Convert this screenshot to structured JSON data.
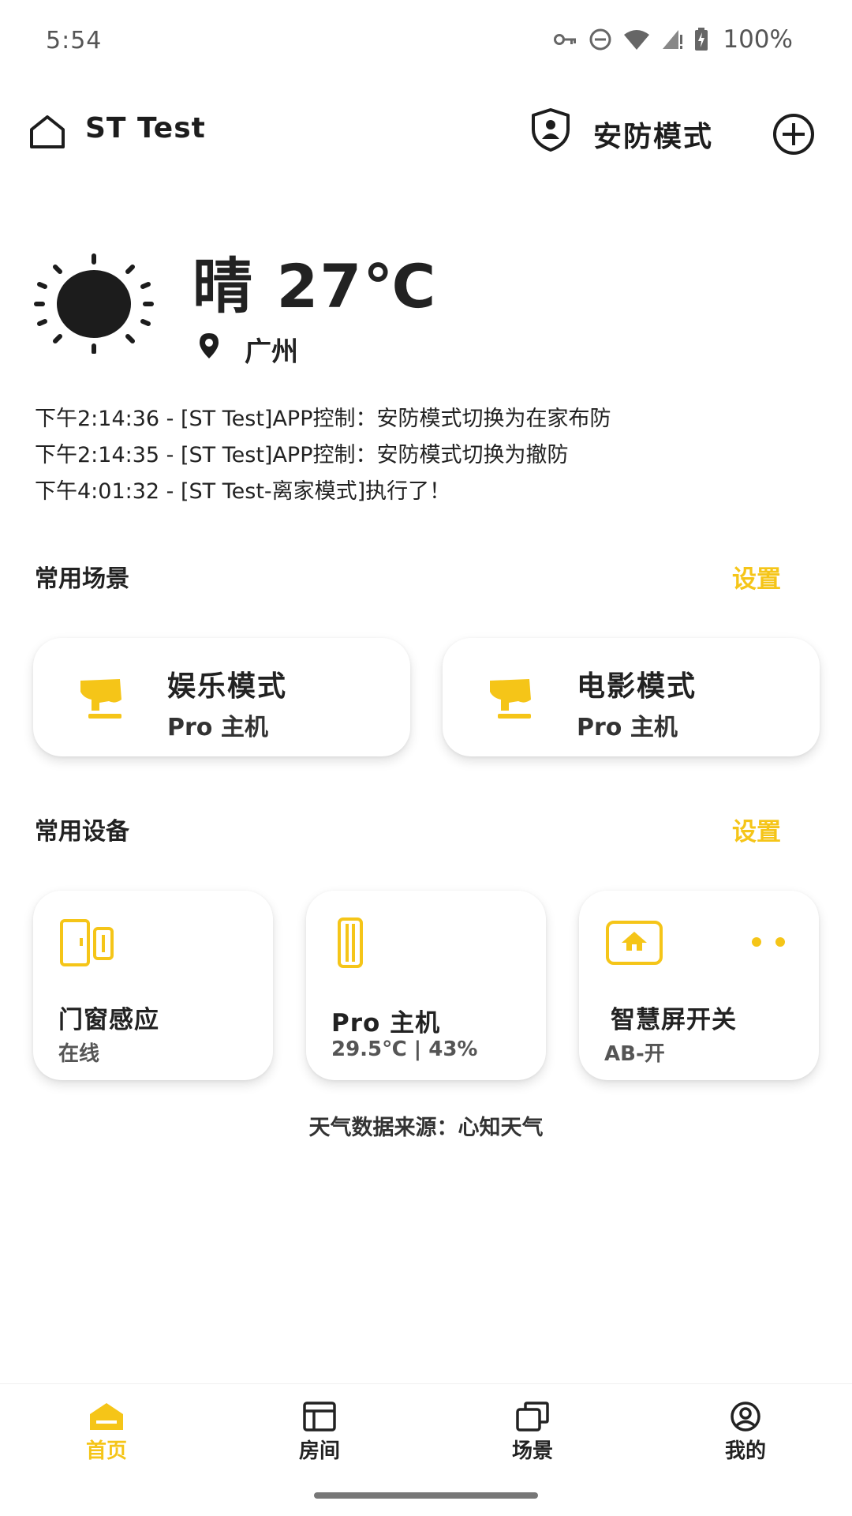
{
  "status_bar": {
    "time": "5:54",
    "battery": "100%",
    "icons": [
      "vpn-key-icon",
      "do-not-disturb-icon",
      "wifi-icon",
      "signal-icon",
      "battery-charging-icon"
    ]
  },
  "header": {
    "home_name": "ST Test",
    "home_icon": "home-icon",
    "security_label": "安防模式",
    "security_icon": "shield-user-icon",
    "add_icon": "add-circle-icon"
  },
  "weather": {
    "condition_temp": "晴 27℃",
    "location": "广州",
    "icon": "sun-icon"
  },
  "logs": [
    "下午2:14:36 - [ST Test]APP控制：安防模式切换为在家布防",
    "下午2:14:35 - [ST Test]APP控制：安防模式切换为撤防",
    "下午4:01:32 - [ST Test-离家模式]执行了！"
  ],
  "scenes_section": {
    "title": "常用场景",
    "action": "设置",
    "items": [
      {
        "name": "娱乐模式",
        "sub": "Pro 主机",
        "icon": "hand-tap-icon"
      },
      {
        "name": "电影模式",
        "sub": "Pro 主机",
        "icon": "hand-tap-icon"
      }
    ]
  },
  "devices_section": {
    "title": "常用设备",
    "action": "设置",
    "items": [
      {
        "name": "门窗感应",
        "sub": "在线",
        "icon": "door-sensor-icon"
      },
      {
        "name": "Pro 主机",
        "sub": "29.5℃ | 43%",
        "icon": "hub-device-icon"
      },
      {
        "name": "智慧屏开关",
        "sub": "AB-开",
        "icon": "smart-screen-switch-icon"
      }
    ]
  },
  "weather_source": "天气数据来源：心知天气",
  "bottom_nav": {
    "items": [
      {
        "label": "首页",
        "icon": "home-filled-icon",
        "active": true
      },
      {
        "label": "房间",
        "icon": "room-icon",
        "active": false
      },
      {
        "label": "场景",
        "icon": "scenes-icon",
        "active": false
      },
      {
        "label": "我的",
        "icon": "profile-icon",
        "active": false
      }
    ]
  },
  "colors": {
    "accent": "#F5C518",
    "text": "#222222",
    "background": "#FFFFFF"
  }
}
